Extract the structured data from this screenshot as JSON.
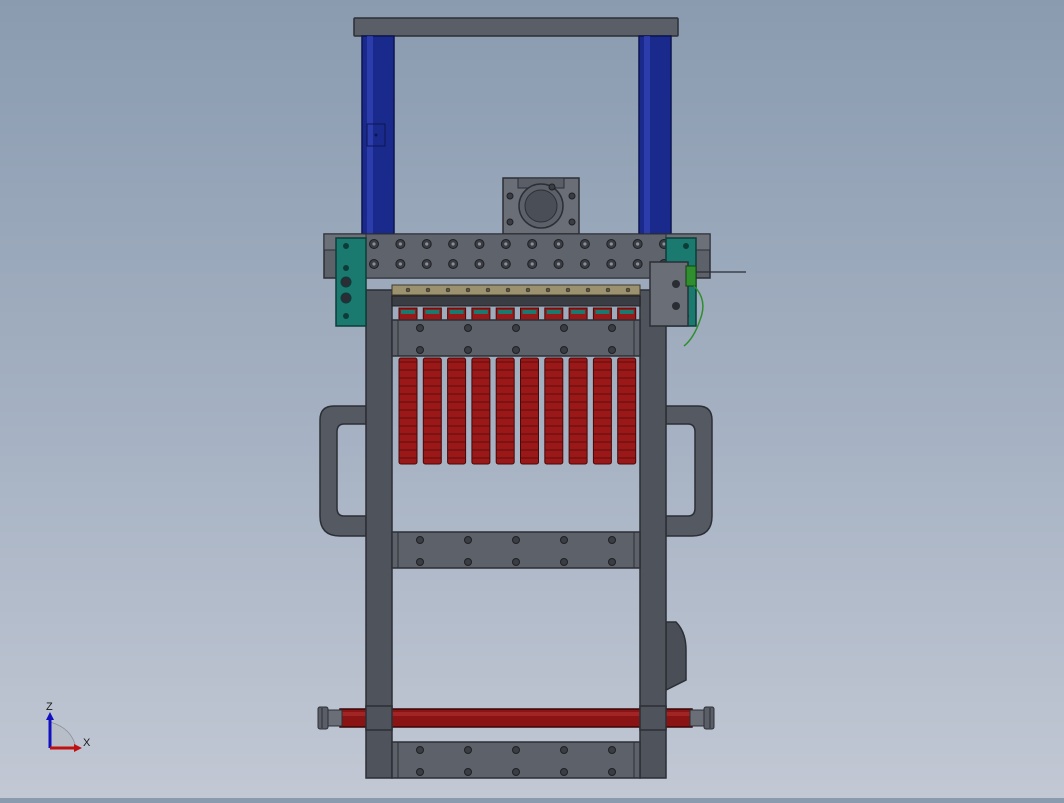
{
  "viewport": {
    "background_top": "#8a9bb0",
    "background_bottom": "#c2c8d4"
  },
  "model": {
    "frame_color": "#4f535b",
    "frame_edge": "#2c2f35",
    "column_color": "#1a2a8c",
    "column_edge": "#0c1550",
    "spring_color": "#9a1818",
    "spring_edge": "#4a0808",
    "bracket_color": "#1a7a70",
    "rail_color": "#9c9270",
    "spring_stack_count": 10,
    "top_bolt_columns": 12,
    "wire_color": "#2f8f2f"
  },
  "triad": {
    "z_label": "Z",
    "x_label": "X",
    "z_color": "#1010c0",
    "x_color": "#c01010"
  }
}
